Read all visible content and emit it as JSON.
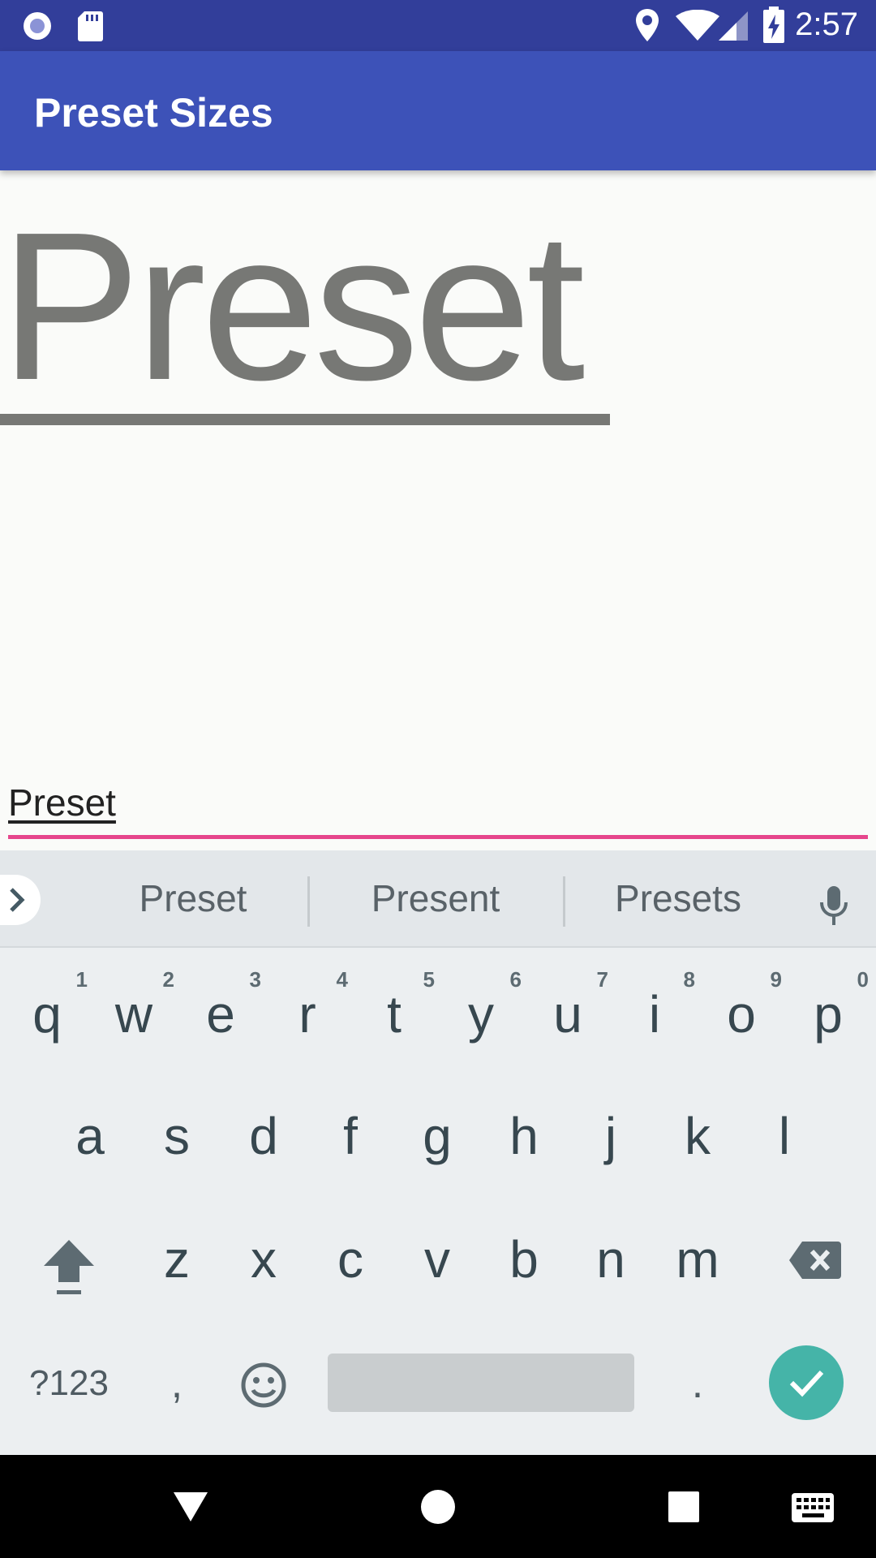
{
  "status_bar": {
    "time": "2:57",
    "left_icons": [
      "record-icon",
      "sd-card-icon"
    ],
    "right_icons": [
      "location-icon",
      "wifi-icon",
      "signal-icon",
      "battery-charging-icon"
    ]
  },
  "app_bar": {
    "title": "Preset Sizes"
  },
  "preview": {
    "text": "Preset"
  },
  "edit_field": {
    "value": "Preset",
    "accent_color": "#e6468c"
  },
  "keyboard": {
    "suggestions": [
      "Preset",
      "Present",
      "Presets"
    ],
    "row1": [
      {
        "key": "q",
        "hint": "1"
      },
      {
        "key": "w",
        "hint": "2"
      },
      {
        "key": "e",
        "hint": "3"
      },
      {
        "key": "r",
        "hint": "4"
      },
      {
        "key": "t",
        "hint": "5"
      },
      {
        "key": "y",
        "hint": "6"
      },
      {
        "key": "u",
        "hint": "7"
      },
      {
        "key": "i",
        "hint": "8"
      },
      {
        "key": "o",
        "hint": "9"
      },
      {
        "key": "p",
        "hint": "0"
      }
    ],
    "row2": [
      "a",
      "s",
      "d",
      "f",
      "g",
      "h",
      "j",
      "k",
      "l"
    ],
    "row3": [
      "z",
      "x",
      "c",
      "v",
      "b",
      "n",
      "m"
    ],
    "symbols_label": "?123",
    "comma_label": ",",
    "period_label": ".",
    "enter_color": "#45b4a8"
  },
  "nav_bar": {
    "icons": [
      "back-icon",
      "home-icon",
      "recents-icon",
      "keyboard-switch-icon"
    ]
  }
}
